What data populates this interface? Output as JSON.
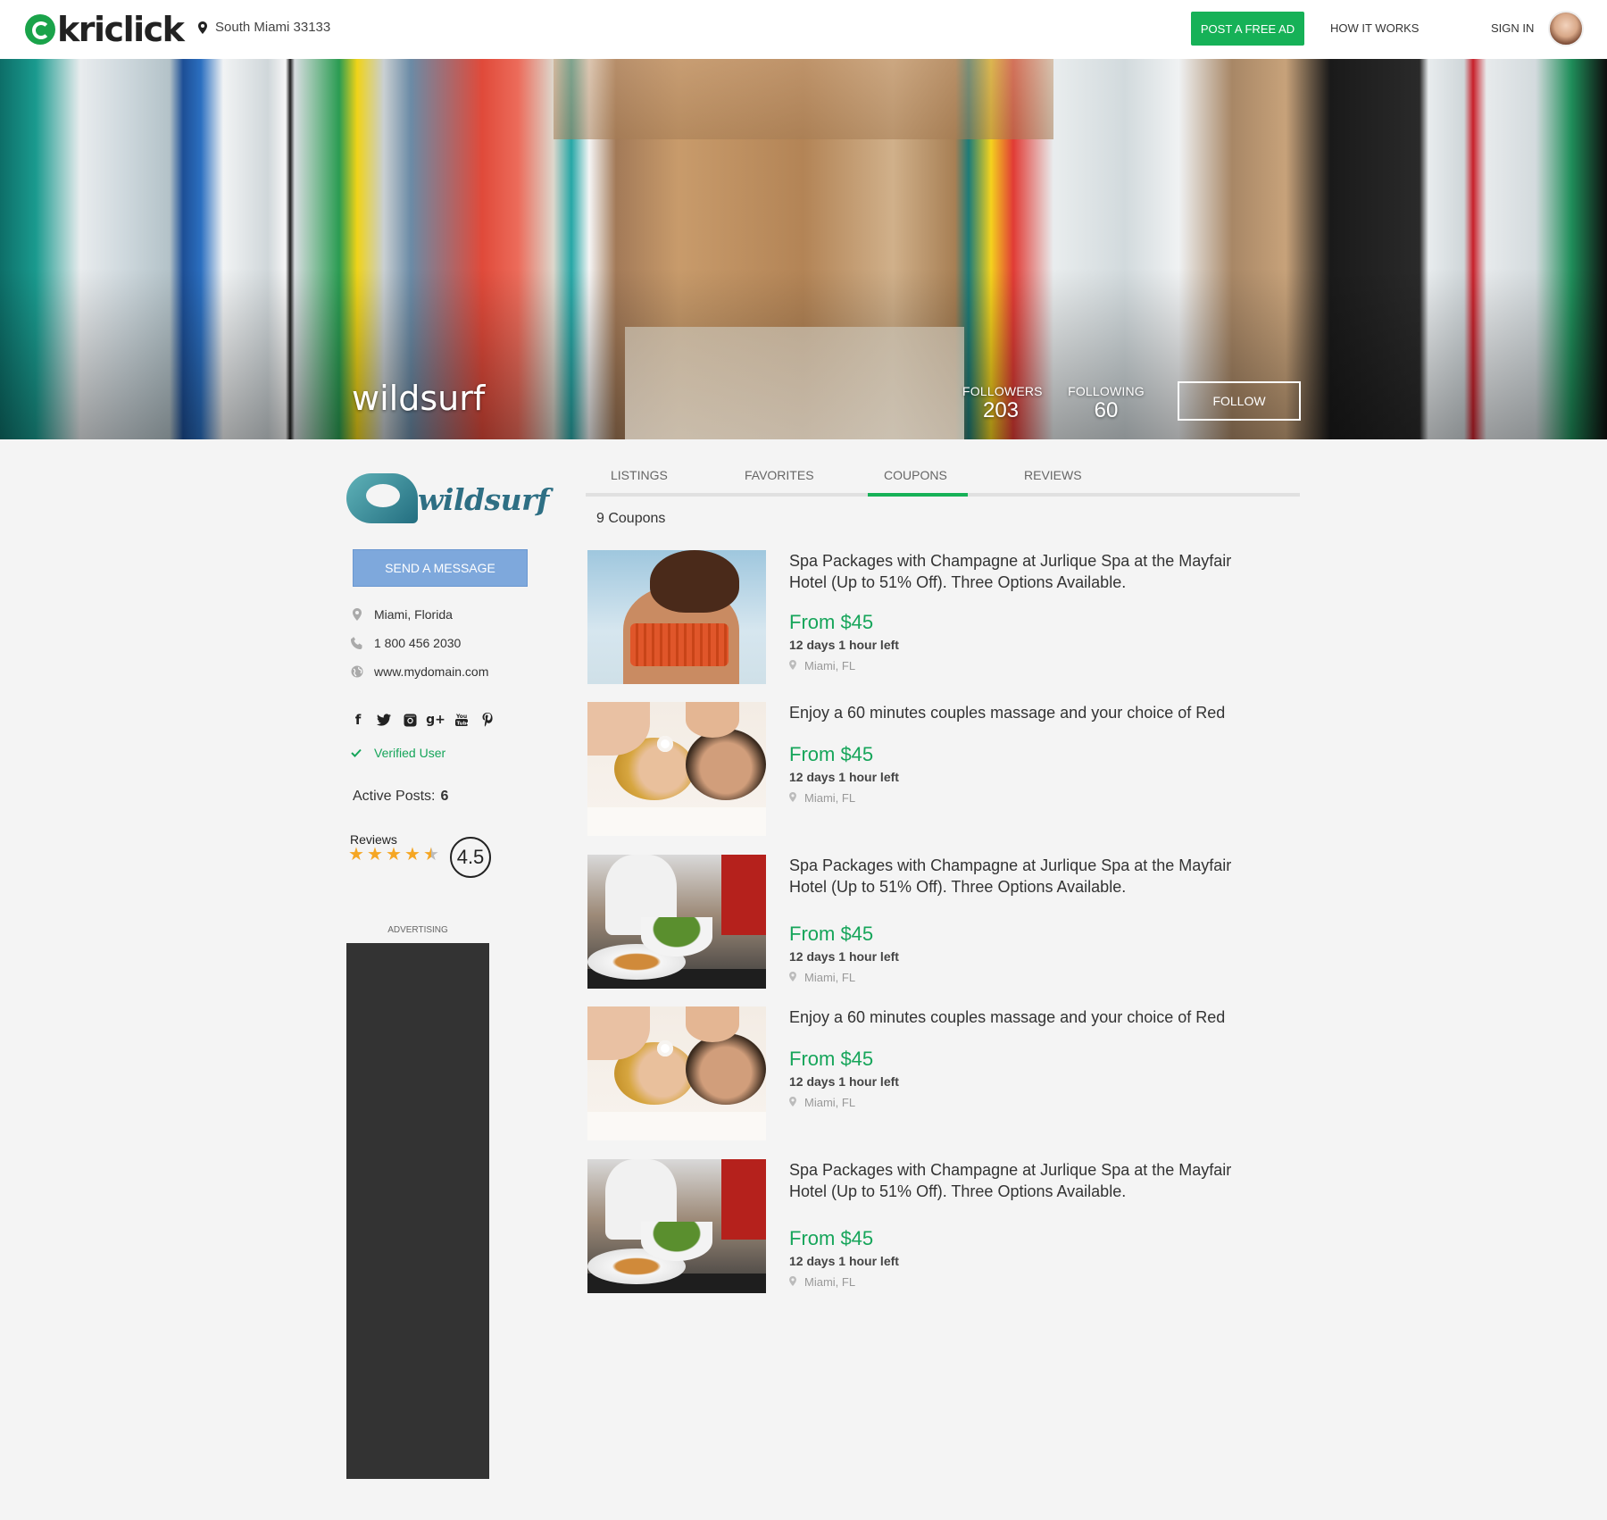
{
  "header": {
    "brand": "kriclick",
    "location": "South Miami 33133",
    "post_ad": "POST A FREE AD",
    "how_it_works": "HOW IT WORKS",
    "sign_in": "SIGN IN"
  },
  "hero": {
    "name": "wildsurf",
    "followers_label": "FOLLOWERS",
    "followers_count": "203",
    "following_label": "FOLLOWING",
    "following_count": "60",
    "follow": "FOLLOW"
  },
  "profile": {
    "logo_text": "wildsurf",
    "send_message": "SEND A MESSAGE",
    "city": "Miami, Florida",
    "phone": "1 800 456 2030",
    "website": "www.mydomain.com",
    "verified": "Verified User",
    "active_posts_label": "Active Posts:",
    "active_posts": "6",
    "reviews_label": "Reviews",
    "rating": "4.5",
    "rating_value": 4.5,
    "rating_max": 5,
    "advertising": "ADVERTISING"
  },
  "social_icons": [
    "facebook-icon",
    "twitter-icon",
    "instagram-icon",
    "google-plus-icon",
    "youtube-icon",
    "pinterest-icon"
  ],
  "tabs": [
    {
      "label": "LISTINGS"
    },
    {
      "label": "FAVORITES"
    },
    {
      "label": "COUPONS",
      "active": true
    },
    {
      "label": "REVIEWS"
    }
  ],
  "coupon_count": "9 Coupons",
  "coupons": [
    {
      "title": "Spa Packages with Champagne at Jurlique Spa at the Mayfair Hotel (Up to 51% Off). Three Options Available.",
      "price": "From $45",
      "time_left": "12 days 1 hour left",
      "location": "Miami, FL",
      "image": "bikini"
    },
    {
      "title": "Enjoy a 60 minutes couples massage and your choice of Red",
      "price": "From $45",
      "time_left": "12 days 1 hour left",
      "location": "Miami, FL",
      "image": "massage"
    },
    {
      "title": "Spa Packages with Champagne at Jurlique Spa at the Mayfair Hotel (Up to 51% Off). Three Options Available.",
      "price": "From $45",
      "time_left": "12 days 1 hour left",
      "location": "Miami, FL",
      "image": "food"
    },
    {
      "title": "Enjoy a 60 minutes couples massage and your choice of Red",
      "price": "From $45",
      "time_left": "12 days 1 hour left",
      "location": "Miami, FL",
      "image": "massage"
    },
    {
      "title": "Spa Packages with Champagne at Jurlique Spa at the Mayfair Hotel (Up to 51% Off). Three Options Available.",
      "price": "From $45",
      "time_left": "12 days 1 hour left",
      "location": "Miami, FL",
      "image": "food"
    }
  ],
  "colors": {
    "accent_green": "#16b157",
    "price_green": "#16a55a",
    "message_blue": "#7ea8dc",
    "star_gold": "#f5a623"
  }
}
